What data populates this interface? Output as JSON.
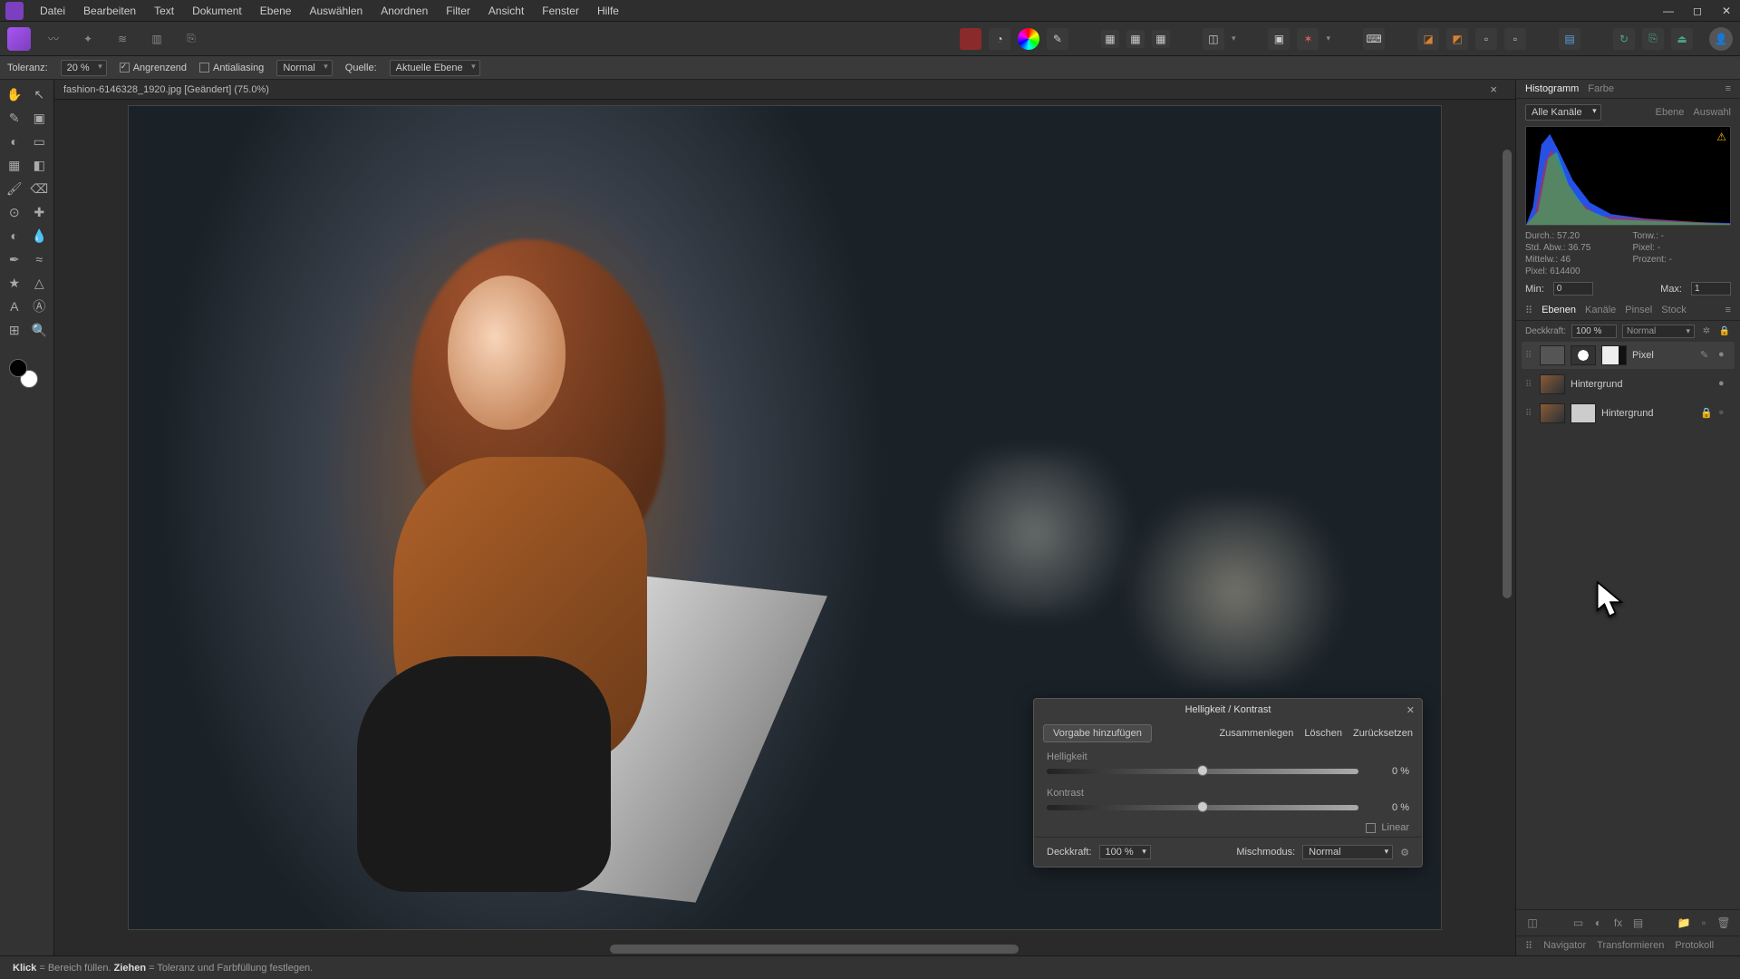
{
  "menu": [
    "Datei",
    "Bearbeiten",
    "Text",
    "Dokument",
    "Ebene",
    "Auswählen",
    "Anordnen",
    "Filter",
    "Ansicht",
    "Fenster",
    "Hilfe"
  ],
  "context_bar": {
    "tolerance_label": "Toleranz:",
    "tolerance_value": "20 %",
    "contiguous": "Angrenzend",
    "antialias": "Antialiasing",
    "mode": "Normal",
    "source_label": "Quelle:",
    "source_value": "Aktuelle Ebene"
  },
  "document_tab": "fashion-6146328_1920.jpg [Geändert] (75.0%)",
  "right_panel": {
    "tabs_top": [
      "Histogramm",
      "Farbe"
    ],
    "channel_select": "Alle Kanäle",
    "mode_labels": [
      "Ebene",
      "Auswahl"
    ],
    "stats": {
      "durch": "Durch.: 57.20",
      "stdabw": "Std. Abw.: 36.75",
      "mittelw": "Mittelw.: 46",
      "pixel": "Pixel: 614400",
      "tonw": "Tonw.: -",
      "pixel2": "Pixel: -",
      "prozent": "Prozent: -"
    },
    "min_label": "Min:",
    "min_value": "0",
    "max_label": "Max:",
    "max_value": "1",
    "tabs_layers": [
      "Ebenen",
      "Kanäle",
      "Pinsel",
      "Stock"
    ],
    "opacity_label": "Deckkraft:",
    "opacity_value": "100 %",
    "blend_mode": "Normal",
    "layers": [
      {
        "name": "Pixel"
      },
      {
        "name": "Hintergrund"
      },
      {
        "name": "Hintergrund"
      }
    ],
    "tabs_bottom": [
      "Navigator",
      "Transformieren",
      "Protokoll"
    ]
  },
  "dialog": {
    "title": "Helligkeit / Kontrast",
    "add_preset": "Vorgabe hinzufügen",
    "merge": "Zusammenlegen",
    "delete": "Löschen",
    "reset": "Zurücksetzen",
    "brightness_label": "Helligkeit",
    "brightness_value": "0 %",
    "contrast_label": "Kontrast",
    "contrast_value": "0 %",
    "linear": "Linear",
    "opacity_label": "Deckkraft:",
    "opacity_value": "100 %",
    "blendmode_label": "Mischmodus:",
    "blendmode_value": "Normal"
  },
  "status": {
    "click": "Klick",
    "click_text": " = Bereich füllen. ",
    "drag": "Ziehen",
    "drag_text": " = Toleranz und Farbfüllung festlegen."
  }
}
